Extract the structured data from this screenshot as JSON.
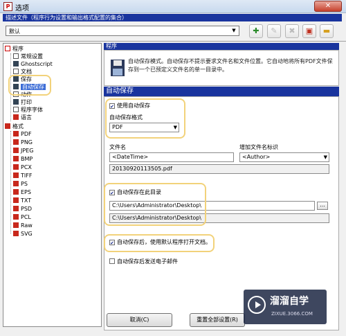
{
  "window": {
    "title": "选项",
    "icon_label": "P",
    "close_label": "✕"
  },
  "profile": {
    "description": "描述文件（程序行为设置和输出格式配置的集合）",
    "selected": "默认",
    "toolbar_icons": [
      "add-profile-icon",
      "rename-profile-icon",
      "delete-profile-icon",
      "save-profile-icon",
      "folder-icon"
    ]
  },
  "tree": {
    "program_label": "程序",
    "program_items": [
      "常规设置",
      "Ghostscript",
      "文档",
      "保存",
      "自动保存",
      "动作",
      "打印",
      "程序字体",
      "语言"
    ],
    "selected_item": "自动保存",
    "format_label": "格式",
    "format_items": [
      "PDF",
      "PNG",
      "JPEG",
      "BMP",
      "PCX",
      "TIFF",
      "PS",
      "EPS",
      "TXT",
      "PSD",
      "PCL",
      "Raw",
      "SVG"
    ]
  },
  "panel": {
    "section_label": "程序",
    "info_text": "自动保存模式。自动保存不提示要求文件名和文件位置。它自动地将所有PDF文件保存到一个已预定义文件名的单一目录中。",
    "header": "自动保存",
    "use_autosave_label": "使用自动保存",
    "use_autosave_checked": true,
    "format_label": "自动保存格式",
    "format_value": "PDF",
    "filename_label": "文件名",
    "filename_value": "<DateTime>",
    "add_token_label": "增加文件名标识",
    "add_token_value": "<Author>",
    "filename_preview": "20130920113505.pdf",
    "autosave_dir_label": "自动保存在此目录",
    "autosave_dir_checked": true,
    "dir_value": "C:\\Users\\Administrator\\Desktop\\",
    "dir_preview": "C:\\Users\\Administrator\\Desktop\\",
    "browse_label": "...",
    "open_after_label": "自动保存后，使用默认程序打开文档。",
    "open_after_checked": true,
    "email_label": "自动保存后发送电子邮件",
    "email_checked": false
  },
  "buttons": {
    "cancel": "取消(C)",
    "reset": "重置全部设置(R)"
  },
  "watermark": {
    "title": "溜溜自学",
    "url": "ZIXUE.3066.COM"
  }
}
